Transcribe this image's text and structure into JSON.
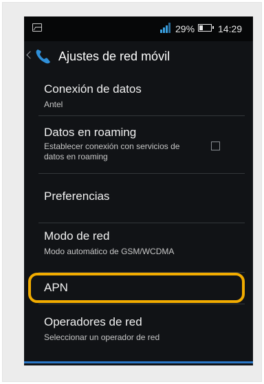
{
  "status": {
    "battery_percent": "29%",
    "time": "14:29",
    "battery_level": 0.29
  },
  "actionbar": {
    "title": "Ajustes de red móvil"
  },
  "items": [
    {
      "title": "Conexión de datos",
      "subtitle": "Antel"
    },
    {
      "title": "Datos en roaming",
      "subtitle": "Establecer conexión con servicios de datos en roaming",
      "checked": false
    },
    {
      "title": "Preferencias",
      "subtitle": ""
    },
    {
      "title": "Modo de red",
      "subtitle": "Modo automático de GSM/WCDMA"
    },
    {
      "title": "APN",
      "subtitle": ""
    },
    {
      "title": "Operadores de red",
      "subtitle": "Seleccionar un operador de red"
    }
  ],
  "colors": {
    "accent": "#2b78c8",
    "highlight": "#f2ac00",
    "signal": "#3aa0e0"
  }
}
